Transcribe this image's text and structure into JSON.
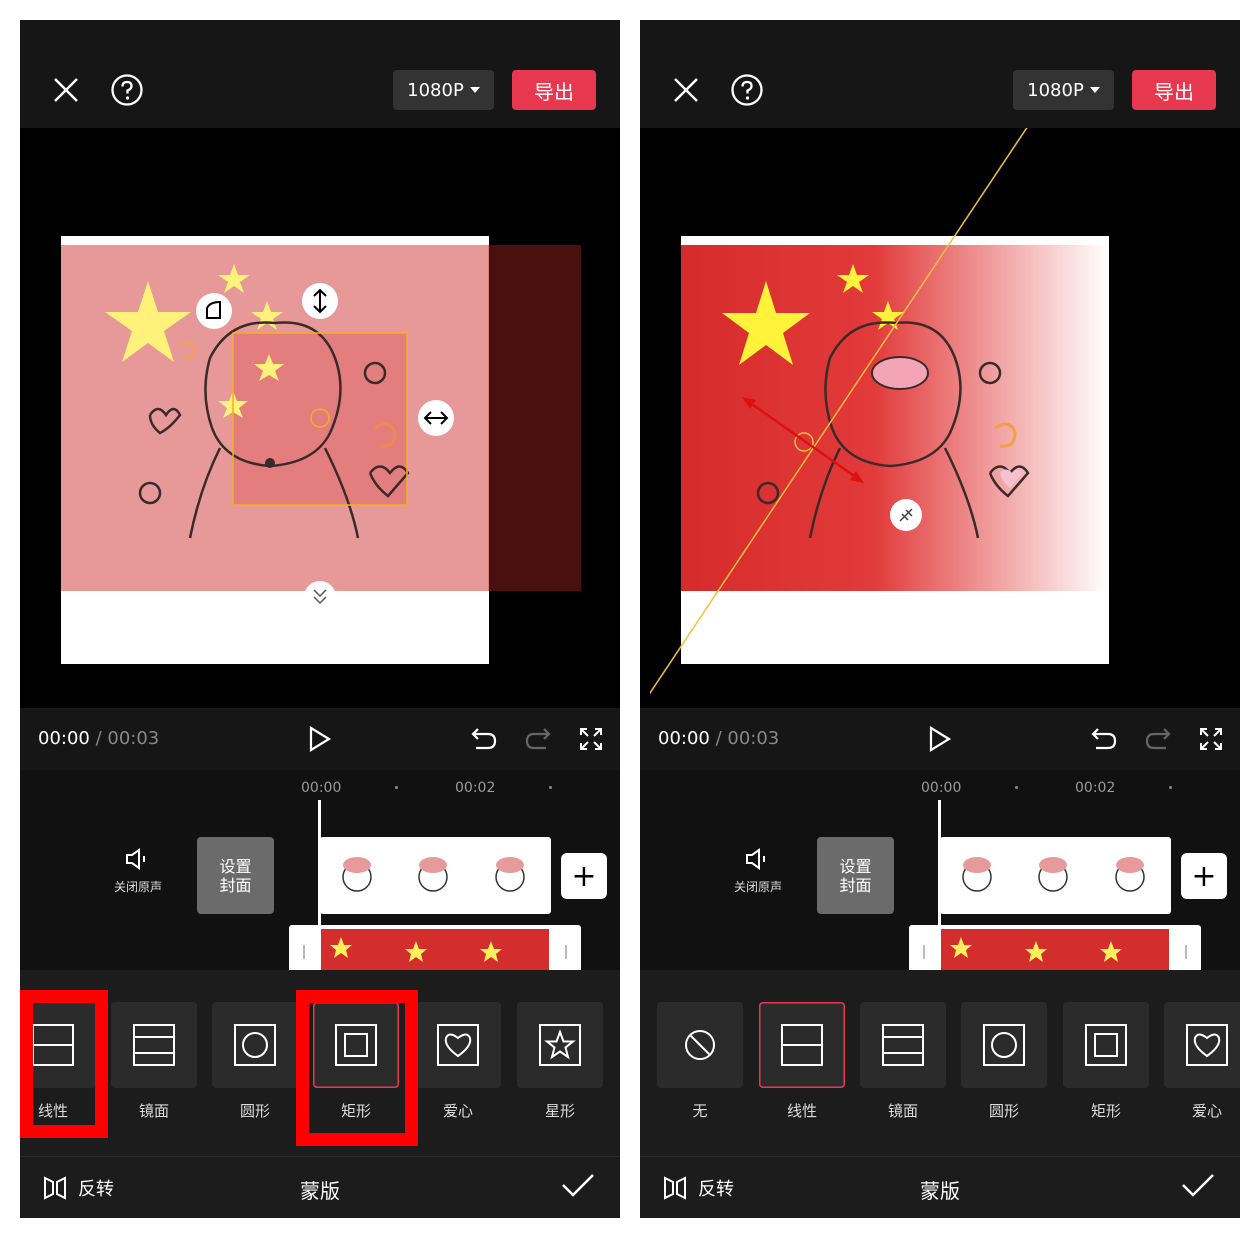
{
  "left": {
    "header": {
      "resolution": "1080P",
      "export_label": "导出"
    },
    "player": {
      "current_time": "00:00",
      "separator": " / ",
      "total_time": "00:03"
    },
    "timeline": {
      "ruler": [
        "00:00",
        "00:02"
      ],
      "mute_label": "关闭原声",
      "cover_label": "设置封面"
    },
    "masks": {
      "items": [
        {
          "label": "线性",
          "icon": "linear-icon"
        },
        {
          "label": "镜面",
          "icon": "mirror-icon"
        },
        {
          "label": "圆形",
          "icon": "circle-icon"
        },
        {
          "label": "矩形",
          "icon": "rectangle-icon",
          "selected": true
        },
        {
          "label": "爱心",
          "icon": "heart-icon"
        },
        {
          "label": "星形",
          "icon": "star-icon"
        }
      ]
    },
    "bottom": {
      "flip_label": "反转",
      "title": "蒙版"
    }
  },
  "right": {
    "header": {
      "resolution": "1080P",
      "export_label": "导出"
    },
    "player": {
      "current_time": "00:00",
      "separator": " / ",
      "total_time": "00:03"
    },
    "timeline": {
      "ruler": [
        "00:00",
        "00:02"
      ],
      "mute_label": "关闭原声",
      "cover_label": "设置封面"
    },
    "masks": {
      "items": [
        {
          "label": "无",
          "icon": "none-icon"
        },
        {
          "label": "线性",
          "icon": "linear-icon",
          "selected": true
        },
        {
          "label": "镜面",
          "icon": "mirror-icon"
        },
        {
          "label": "圆形",
          "icon": "circle-icon"
        },
        {
          "label": "矩形",
          "icon": "rectangle-icon"
        },
        {
          "label": "爱心",
          "icon": "heart-icon"
        }
      ]
    },
    "bottom": {
      "flip_label": "反转",
      "title": "蒙版"
    }
  },
  "colors": {
    "accent": "#e8384f",
    "highlight": "#ff0000",
    "flag_red": "#d32d2d",
    "star_yellow": "#ffef5a"
  }
}
